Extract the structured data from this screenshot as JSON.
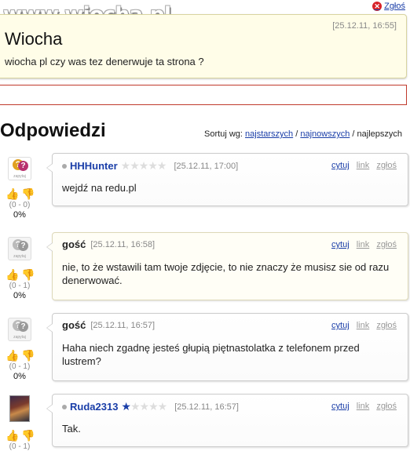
{
  "header": {
    "watermark": "www.wiocha.pl",
    "report_label": "Zgłoś"
  },
  "question": {
    "title": "Wiocha",
    "date": "[25.12.11, 16:55]",
    "body": "wiocha pl czy was tez denerwuje ta strona ?"
  },
  "answers_section": {
    "title": "Odpowiedzi",
    "sort_prefix": "Sortuj wg:",
    "sort_oldest": "najstarszych",
    "sort_newest": "najnowszych",
    "sort_best": "najlepszych",
    "sep": "/"
  },
  "actions": {
    "quote": "cytuj",
    "link": "link",
    "report": "zgłoś"
  },
  "avatar_caption": "zapytaj",
  "answers": [
    {
      "author": "HHHunter",
      "stars": 0,
      "date": "[25.12.11, 17:00]",
      "text": "wejdź na redu.pl",
      "votes": "(0 - 0)",
      "percent": "0%"
    },
    {
      "author": "gość",
      "date": "[25.12.11, 16:58]",
      "text": "nie, to że wstawili tam twoje zdjęcie, to nie znaczy że musisz sie od razu denerwować.",
      "votes": "(0 - 1)",
      "percent": "0%"
    },
    {
      "author": "gość",
      "date": "[25.12.11, 16:57]",
      "text": "Haha niech zgadnę jesteś głupią piętnastolatka z telefonem przed lustrem?",
      "votes": "(0 - 1)",
      "percent": "0%"
    },
    {
      "author": "Ruda2313",
      "stars": 1,
      "date": "[25.12.11, 16:57]",
      "text": "Tak.",
      "votes": "(0 - 1)",
      "percent": ""
    }
  ],
  "colors": {
    "link": "#1a3ea8",
    "question_bg": "#fffde8",
    "thumb_up": "#c0308a",
    "thumb_down": "#d89a10",
    "report_icon": "#d8232a"
  }
}
